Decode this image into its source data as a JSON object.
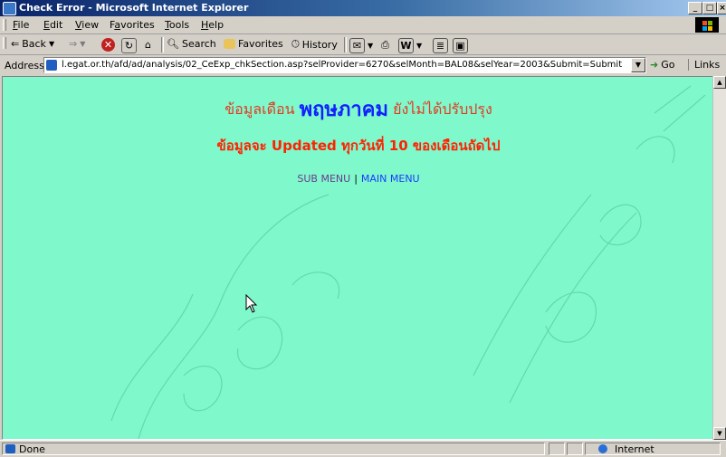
{
  "window": {
    "title": "Check Error - Microsoft Internet Explorer"
  },
  "menu": [
    "File",
    "Edit",
    "View",
    "Favorites",
    "Tools",
    "Help"
  ],
  "menu_accel": [
    "F",
    "E",
    "V",
    "a",
    "T",
    "H"
  ],
  "toolbar": {
    "back": "Back",
    "search": "Search",
    "favorites": "Favorites",
    "history": "History"
  },
  "address": {
    "label": "Address",
    "url": "l.egat.or.th/afd/ad/analysis/02_CeExp_chkSection.asp?selProvider=6270&selMonth=BAL08&selYear=2003&Submit=Submit",
    "go": "Go",
    "links": "Links"
  },
  "content": {
    "line1_prefix": "ข้อมูลเดือน",
    "month": "พฤษภาคม",
    "line1_suffix": "ยังไม่ได้ปรับปรุง",
    "line2": "ข้อมูลจะ Updated ทุกวันที่ 10 ของเดือนถัดไป",
    "sub_menu": "SUB MENU",
    "main_menu": "MAIN MENU"
  },
  "status": {
    "text": "Done",
    "zone": "Internet"
  },
  "colors": {
    "page_bg": "#7ff8cc",
    "red_text": "#e23a22",
    "blue_text": "#1220ff"
  }
}
